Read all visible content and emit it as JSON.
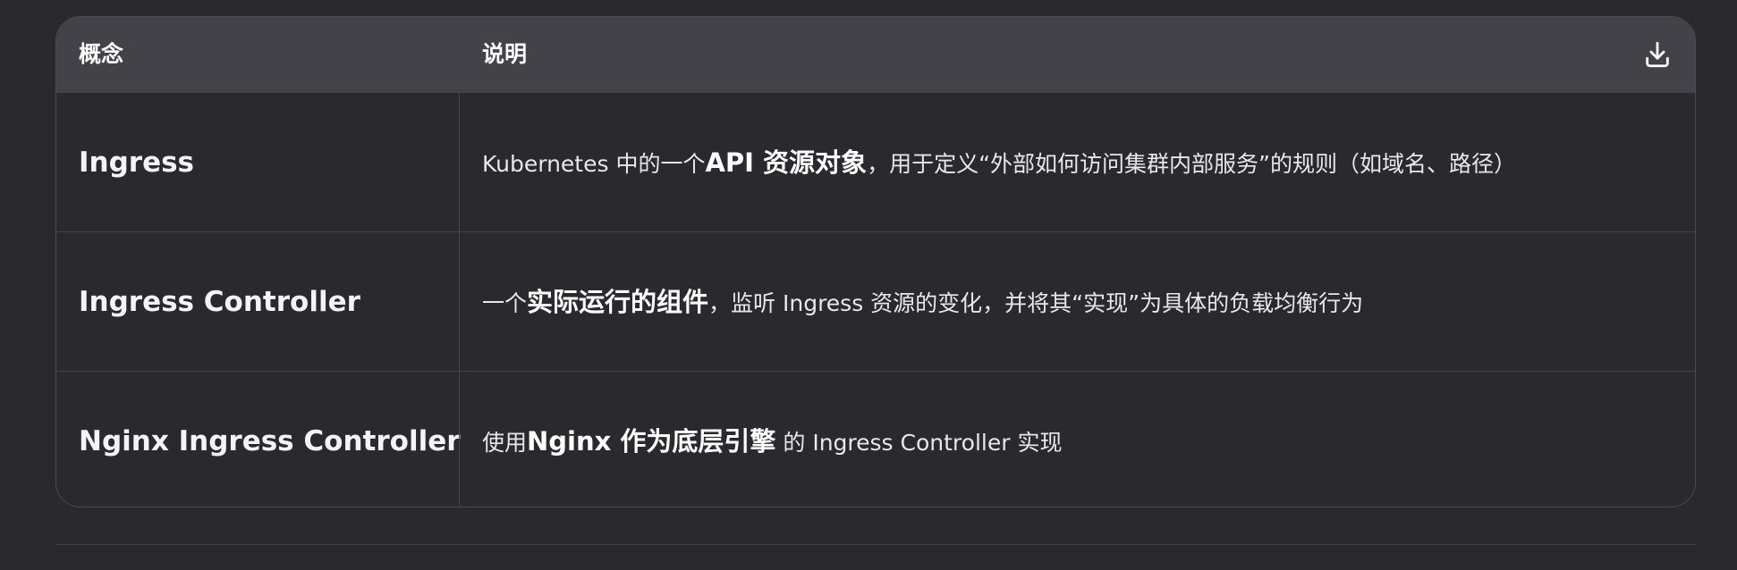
{
  "table": {
    "headers": {
      "concept": "概念",
      "description": "说明"
    },
    "download_icon": "download-icon",
    "rows": [
      {
        "term": "Ingress",
        "desc_before": "Kubernetes 中的一个",
        "desc_bold": "API 资源对象",
        "desc_after": "，用于定义“外部如何访问集群内部服务”的规则（如域名、路径）"
      },
      {
        "term": "Ingress Controller",
        "desc_before": "一个",
        "desc_bold": "实际运行的组件",
        "desc_after": "，监听 Ingress 资源的变化，并将其“实现”为具体的负载均衡行为"
      },
      {
        "term": "Nginx Ingress Controller",
        "desc_before": "使用",
        "desc_bold": "Nginx 作为底层引擎",
        "desc_after": " 的 Ingress Controller 实现"
      }
    ]
  }
}
